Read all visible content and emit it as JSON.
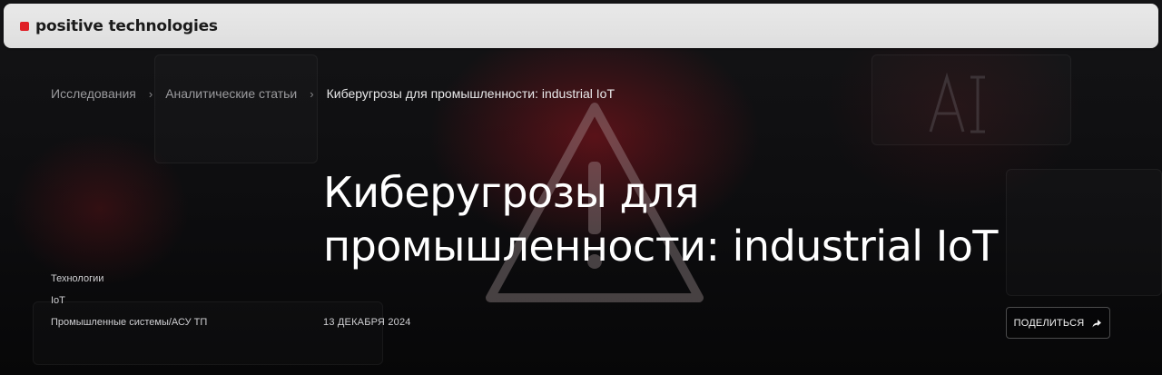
{
  "header": {
    "logo_text": "positive technologies",
    "brand_color": "#e01f26"
  },
  "breadcrumb": {
    "items": [
      "Исследования",
      "Аналитические статьи"
    ],
    "current": "Киберугрозы для промышленности: industrial IoT",
    "separator": "›"
  },
  "article": {
    "title_line1": "Киберугрозы для",
    "title_line2": "промышленности: industrial IoT",
    "date": "13 ДЕКАБРЯ 2024",
    "tags": [
      "Технологии",
      "IoT",
      "Промышленные системы/АСУ ТП"
    ]
  },
  "share": {
    "label": "ПОДЕЛИТЬСЯ",
    "icon": "share-arrow-icon"
  }
}
